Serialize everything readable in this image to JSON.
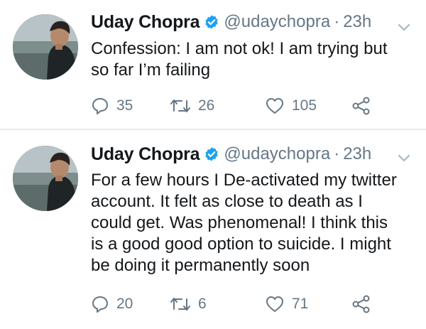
{
  "tweets": [
    {
      "author": {
        "name": "Uday Chopra",
        "verified_icon": "verified-badge-icon",
        "handle": "@udaychopra"
      },
      "separator": "·",
      "time": "23h",
      "text": "Confession: I am not ok! I am trying but\nso far I’m failing",
      "actions": {
        "replies": "35",
        "retweets": "26",
        "likes": "105"
      }
    },
    {
      "author": {
        "name": "Uday Chopra",
        "verified_icon": "verified-badge-icon",
        "handle": "@udaychopra"
      },
      "separator": "·",
      "time": "23h",
      "text": "For a few hours I De-activated my twitter\naccount. It felt as close to death as I\ncould get. Was phenomenal! I think this\nis a good good option to suicide. I might\nbe doing it permanently soon",
      "actions": {
        "replies": "20",
        "retweets": "6",
        "likes": "71"
      }
    }
  ],
  "colors": {
    "text_primary": "#14171a",
    "text_secondary": "#657786",
    "verified_blue": "#1da1f2",
    "divider": "#e6ecf0"
  }
}
